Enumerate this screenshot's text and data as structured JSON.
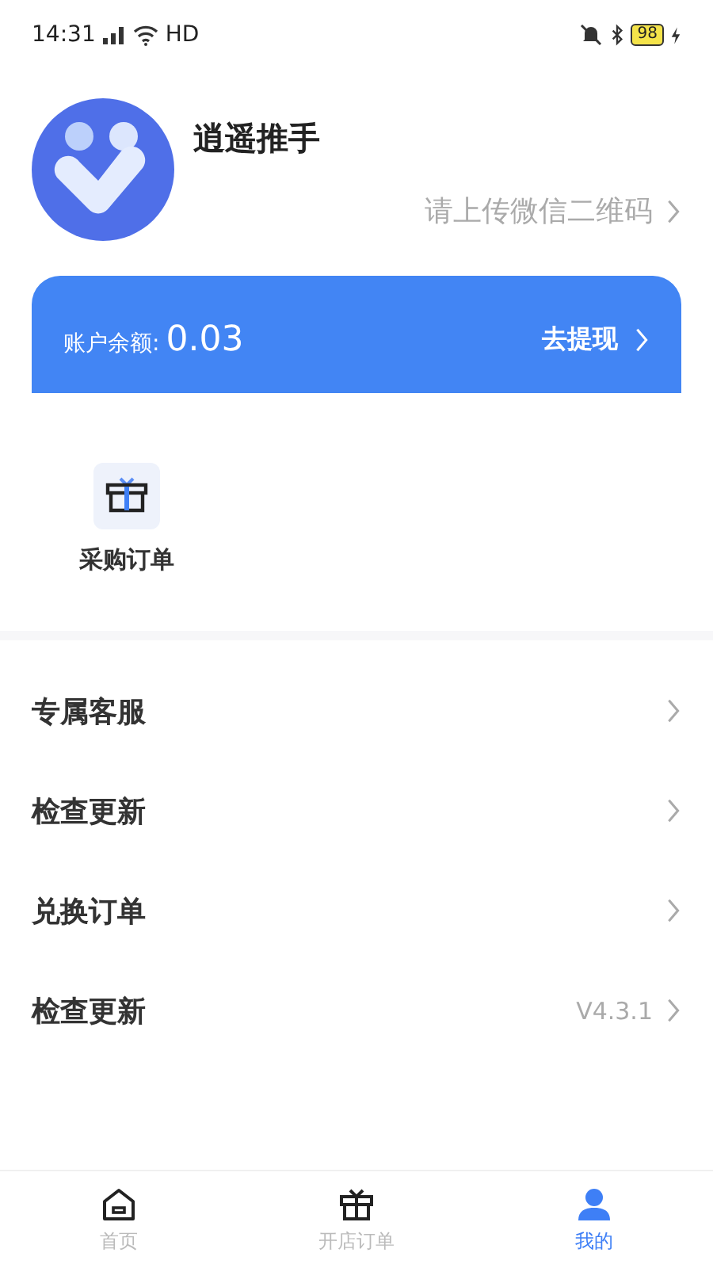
{
  "status_bar": {
    "time": "14:31",
    "network": "HD",
    "battery": "98"
  },
  "profile": {
    "name": "逍遥推手",
    "qr_prompt": "请上传微信二维码"
  },
  "balance": {
    "label": "账户余额:",
    "amount": "0.03",
    "action": "去提现"
  },
  "shortcuts": [
    {
      "label": "采购订单"
    }
  ],
  "menu": [
    {
      "label": "专属客服"
    },
    {
      "label": "检查更新"
    },
    {
      "label": "兑换订单"
    },
    {
      "label": "检查更新",
      "value": "V4.3.1"
    }
  ],
  "tabs": [
    {
      "label": "首页",
      "kind": "home",
      "selected": false
    },
    {
      "label": "开店订单",
      "kind": "gift",
      "selected": false
    },
    {
      "label": "我的",
      "kind": "person",
      "selected": true
    }
  ]
}
